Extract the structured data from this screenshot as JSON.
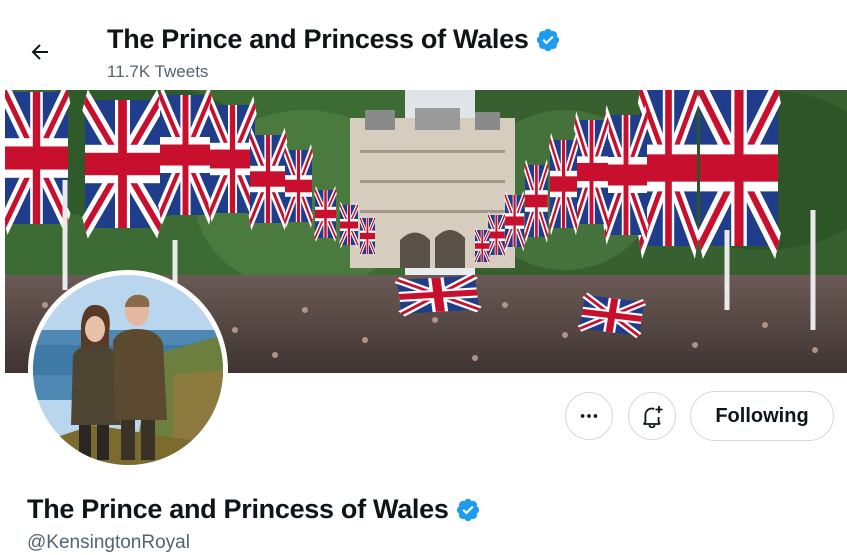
{
  "header": {
    "title": "The Prince and Princess of Wales",
    "tweet_count": "11.7K Tweets",
    "back_icon": "arrow-left-icon"
  },
  "profile": {
    "name": "The Prince and Princess of Wales",
    "handle": "@KensingtonRoyal",
    "verified_icon": "verified-badge-icon"
  },
  "actions": {
    "more_icon": "more-horizontal-icon",
    "notify_icon": "bell-plus-icon",
    "following_label": "Following"
  },
  "colors": {
    "verified": "#1d9bf0",
    "text_primary": "#0f1419",
    "text_secondary": "#536471",
    "border": "#cfd9de"
  }
}
